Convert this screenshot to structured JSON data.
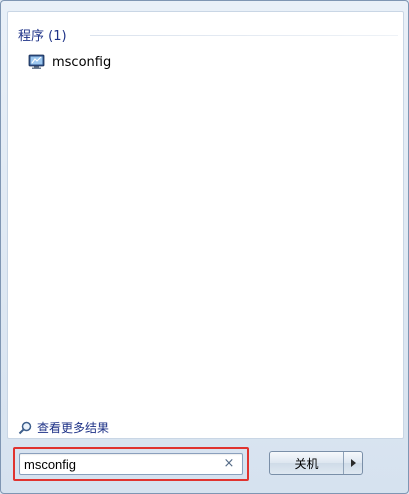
{
  "results": {
    "group_title": "程序 (1)",
    "items": [
      {
        "label": "msconfig",
        "icon": "system-config-icon"
      }
    ],
    "see_more": "查看更多结果"
  },
  "search": {
    "value": "msconfig",
    "clear_glyph": "×"
  },
  "shutdown": {
    "label": "关机"
  },
  "colors": {
    "group_title": "#1e3287",
    "highlight_border": "#e0332f"
  }
}
